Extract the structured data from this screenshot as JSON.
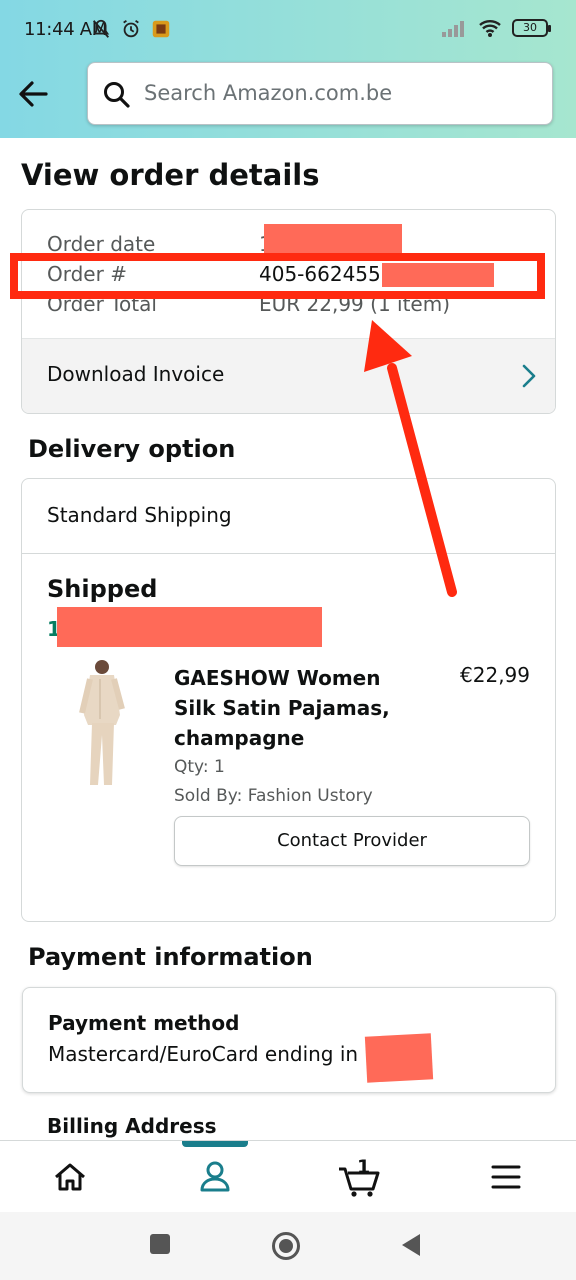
{
  "status_bar": {
    "time": "11:44 AM",
    "battery": "30"
  },
  "search": {
    "placeholder": "Search Amazon.com.be"
  },
  "page": {
    "title": "View order details"
  },
  "order_summary": {
    "order_date_label": "Order date",
    "order_date_value": "1",
    "order_number_label": "Order #",
    "order_number_value": "405-662455",
    "order_total_label": "Order Total",
    "order_total_value": "EUR 22,99 (1 item)",
    "download_invoice": "Download Invoice"
  },
  "delivery": {
    "section_title": "Delivery option",
    "option": "Standard Shipping",
    "status": "Shipped",
    "date_stub": "1",
    "product": {
      "name": "GAESHOW Women Silk Satin Pajamas, champagne",
      "price": "€22,99",
      "qty": "Qty: 1",
      "sold_by": "Sold By: Fashion Ustory",
      "contact_button": "Contact Provider"
    }
  },
  "payment": {
    "section_title": "Payment information",
    "method_heading": "Payment method",
    "method_value": "Mastercard/EuroCard  ending in",
    "billing_heading": "Billing Address"
  },
  "bottom_nav": {
    "cart_count": "1",
    "active": "account"
  },
  "colors": {
    "accent": "#1a7e8c",
    "annotation_red": "#ff2a10",
    "redaction": "#ff6a58",
    "delivery_green": "#067d62"
  }
}
